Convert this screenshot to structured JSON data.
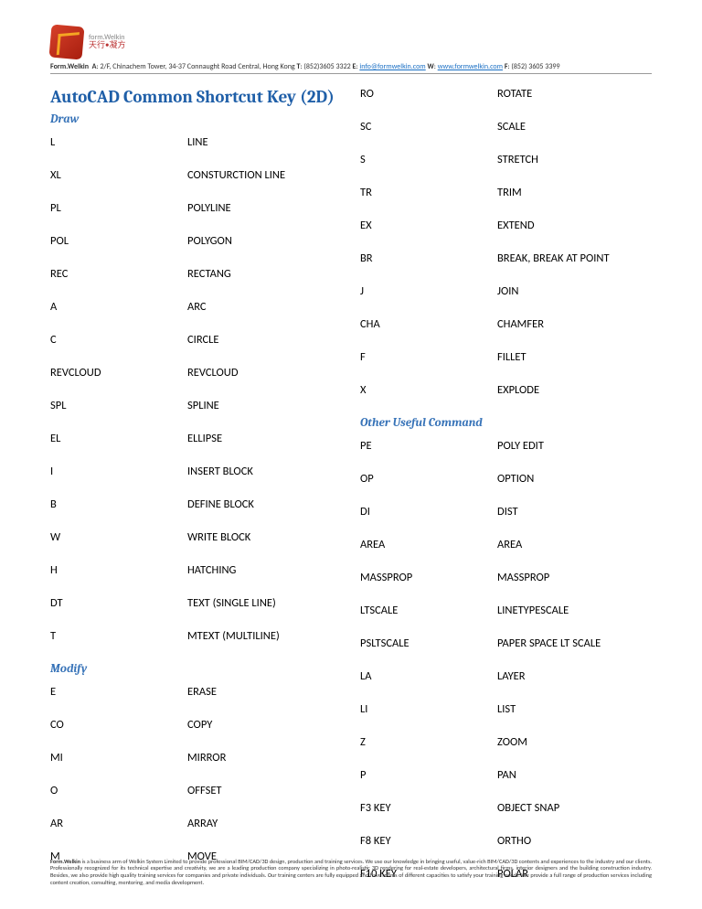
{
  "header": {
    "company": "Form.Welkin",
    "address_label": "A",
    "address": ": 2/F, Chinachem Tower, 34-37 Connaught Road Central, Hong Kong ",
    "tel_label": "T",
    "tel": ": (852)3605 3322 ",
    "email_label": "E",
    "email_prefix": ": ",
    "email": "info@formwelkin.com",
    "web_label": "W",
    "web_prefix": ": ",
    "web": "www.formwelkin.com",
    "fax_label": "F",
    "fax": ": (852) 3605 3399",
    "logo_text_top": "form.Welkin",
    "logo_text_bottom": "天行•凝方"
  },
  "title": "AutoCAD Common Shortcut Key (2D)",
  "sections": {
    "draw": {
      "heading": "Draw",
      "rows": [
        {
          "k": "L",
          "v": "LINE"
        },
        {
          "k": "XL",
          "v": "CONSTURCTION LINE"
        },
        {
          "k": "PL",
          "v": "POLYLINE"
        },
        {
          "k": "POL",
          "v": "POLYGON"
        },
        {
          "k": "REC",
          "v": "RECTANG"
        },
        {
          "k": "A",
          "v": "ARC"
        },
        {
          "k": "C",
          "v": "CIRCLE"
        },
        {
          "k": "REVCLOUD",
          "v": "REVCLOUD"
        },
        {
          "k": "SPL",
          "v": "SPLINE"
        },
        {
          "k": "EL",
          "v": "ELLIPSE"
        },
        {
          "k": "I",
          "v": "INSERT BLOCK"
        },
        {
          "k": "B",
          "v": "DEFINE BLOCK"
        },
        {
          "k": "W",
          "v": "WRITE BLOCK"
        },
        {
          "k": "H",
          "v": "HATCHING"
        },
        {
          "k": "DT",
          "v": "TEXT (SINGLE LINE)"
        },
        {
          "k": "T",
          "v": "MTEXT (MULTILINE)"
        }
      ]
    },
    "modify": {
      "heading": "Modify",
      "rows": [
        {
          "k": "E",
          "v": "ERASE"
        },
        {
          "k": "CO",
          "v": "COPY"
        },
        {
          "k": "MI",
          "v": "MIRROR"
        },
        {
          "k": "O",
          "v": "OFFSET"
        },
        {
          "k": "AR",
          "v": "ARRAY"
        },
        {
          "k": "M",
          "v": "MOVE"
        }
      ]
    },
    "modify_cont": {
      "rows": [
        {
          "k": "RO",
          "v": "ROTATE"
        },
        {
          "k": "SC",
          "v": "SCALE"
        },
        {
          "k": "S",
          "v": "STRETCH"
        },
        {
          "k": "TR",
          "v": "TRIM"
        },
        {
          "k": "EX",
          "v": "EXTEND"
        },
        {
          "k": "BR",
          "v": "BREAK, BREAK AT POINT"
        },
        {
          "k": "J",
          "v": "JOIN"
        },
        {
          "k": "CHA",
          "v": "CHAMFER"
        },
        {
          "k": "F",
          "v": "FILLET"
        },
        {
          "k": "X",
          "v": "EXPLODE"
        }
      ]
    },
    "other": {
      "heading": "Other Useful Command",
      "rows": [
        {
          "k": "PE",
          "v": "POLY EDIT"
        },
        {
          "k": "OP",
          "v": "OPTION"
        },
        {
          "k": "DI",
          "v": "DIST"
        },
        {
          "k": "AREA",
          "v": "AREA"
        },
        {
          "k": "MASSPROP",
          "v": "MASSPROP"
        },
        {
          "k": "LTSCALE",
          "v": "LINETYPESCALE"
        },
        {
          "k": "PSLTSCALE",
          "v": "PAPER SPACE LT SCALE"
        },
        {
          "k": "LA",
          "v": "LAYER"
        },
        {
          "k": "LI",
          "v": "LIST"
        },
        {
          "k": "Z",
          "v": "ZOOM"
        },
        {
          "k": "P",
          "v": "PAN"
        },
        {
          "k": "F3 KEY",
          "v": "OBJECT SNAP"
        },
        {
          "k": "F8 KEY",
          "v": "ORTHO"
        },
        {
          "k": "F10 KEY",
          "v": "POLAR"
        }
      ]
    }
  },
  "footer": {
    "company": "Form.Welkin",
    "text": " is a business arm of Welkin System Limited to provide professional BIM/CAD/3D design, production and training services. We use our knowledge in bringing useful, value-rich BIM/CAD/3D contents and experiences to the industry and our clients. Professionally recognized for its technical expertise and creativity, we are a leading production company specializing in photo-realistic 3D rendering for real-estate developers, architectural firms, interior designers and the building construction industry. Besides, we also provide high quality training services for companies and private individuals. Our training centers are fully equipped and have rooms of different capacities to satisfy your training needs. We provide a full range of production services including content creation, consulting, mentoring, and media development."
  }
}
